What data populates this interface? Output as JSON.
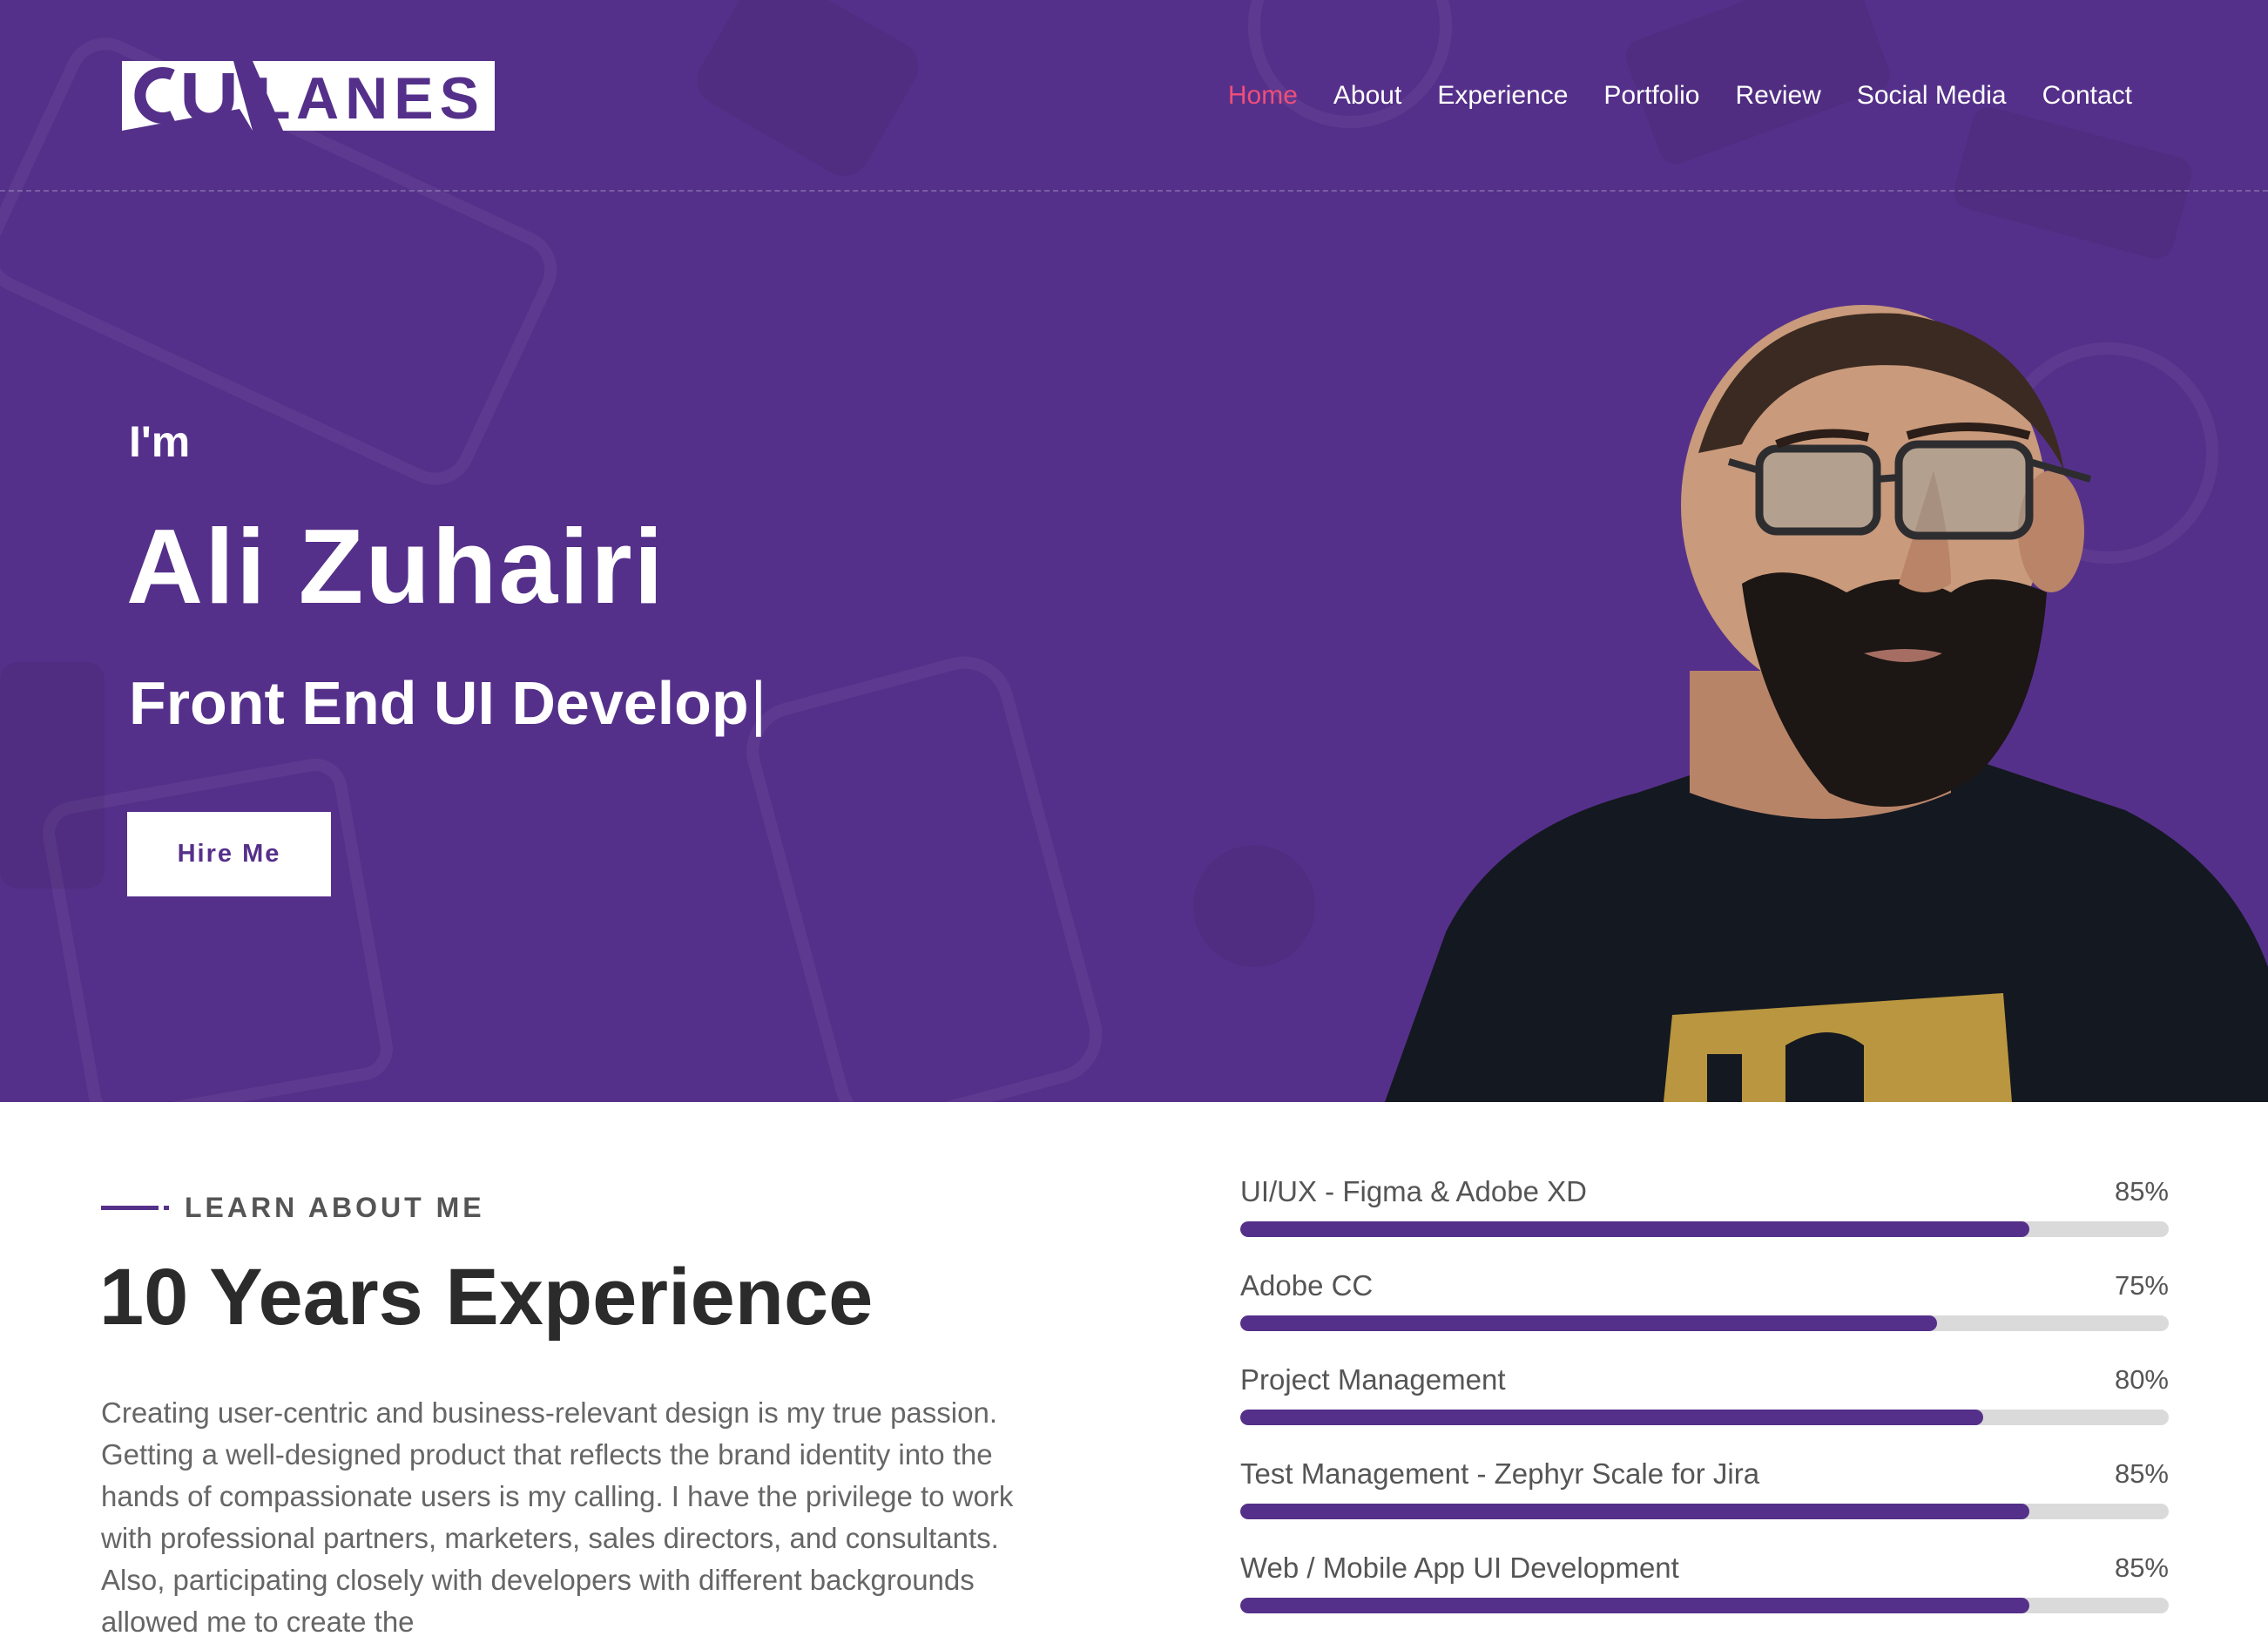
{
  "brand": {
    "logo_text": "CU LANES",
    "colors": {
      "hero_bg": "#55308a",
      "accent": "#f04e7a",
      "white": "#ffffff",
      "bar_track": "#dadada"
    }
  },
  "nav": {
    "items": [
      {
        "label": "Home",
        "active": true
      },
      {
        "label": "About",
        "active": false
      },
      {
        "label": "Experience",
        "active": false
      },
      {
        "label": "Portfolio",
        "active": false
      },
      {
        "label": "Review",
        "active": false
      },
      {
        "label": "Social Media",
        "active": false
      },
      {
        "label": "Contact",
        "active": false
      }
    ]
  },
  "hero": {
    "intro": "I'm",
    "name": "Ali Zuhairi",
    "role": "Front End UI Develop",
    "cursor": "|",
    "cta": "Hire Me"
  },
  "about": {
    "eyebrow": "LEARN ABOUT ME",
    "title": "10 Years Experience",
    "text": "Creating user-centric and business-relevant design is my true passion. Getting a well-designed product that reflects the brand identity into the hands of compassionate users is my calling. I have the privilege to work with professional partners, marketers, sales directors, and consultants. Also, participating closely with developers with different backgrounds allowed me to create the",
    "skills": [
      {
        "name": "UI/UX - Figma & Adobe XD",
        "percent_label": "85%",
        "value": 85
      },
      {
        "name": "Adobe CC",
        "percent_label": "75%",
        "value": 75
      },
      {
        "name": "Project Management",
        "percent_label": "80%",
        "value": 80
      },
      {
        "name": "Test Management - Zephyr Scale for Jira",
        "percent_label": "85%",
        "value": 85
      },
      {
        "name": "Web / Mobile App UI Development",
        "percent_label": "85%",
        "value": 85
      }
    ]
  }
}
